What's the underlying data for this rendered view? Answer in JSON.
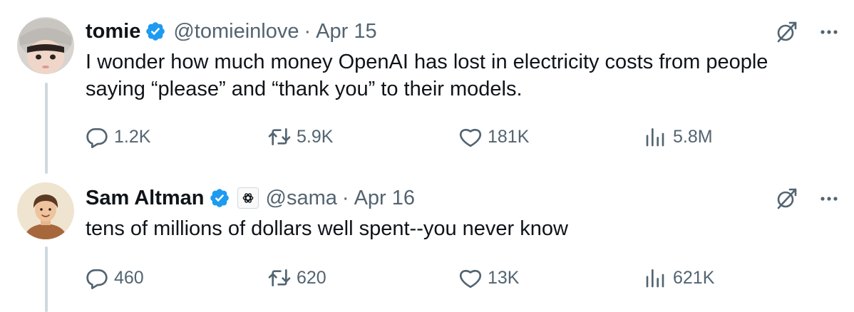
{
  "tweets": [
    {
      "name": "tomie",
      "handle": "@tomieinlove",
      "date": "Apr 15",
      "text": "I wonder how much money OpenAI has lost in electricity costs from people saying “please” and “thank you” to their models.",
      "replies": "1.2K",
      "retweets": "5.9K",
      "likes": "181K",
      "views": "5.8M",
      "verified": true,
      "affiliate_badge": false
    },
    {
      "name": "Sam Altman",
      "handle": "@sama",
      "date": "Apr 16",
      "text": "tens of millions of dollars well spent--you never know",
      "replies": "460",
      "retweets": "620",
      "likes": "13K",
      "views": "621K",
      "verified": true,
      "affiliate_badge": true
    }
  ],
  "separator": "·",
  "colors": {
    "verified": "#1d9bf0",
    "secondary_text": "#536471",
    "primary_text": "#0f1419",
    "thread_line": "#cfd9de"
  },
  "icons": [
    "verified-badge-icon",
    "openai-affiliate-icon",
    "grok-icon",
    "more-icon",
    "reply-icon",
    "retweet-icon",
    "like-icon",
    "views-icon"
  ]
}
